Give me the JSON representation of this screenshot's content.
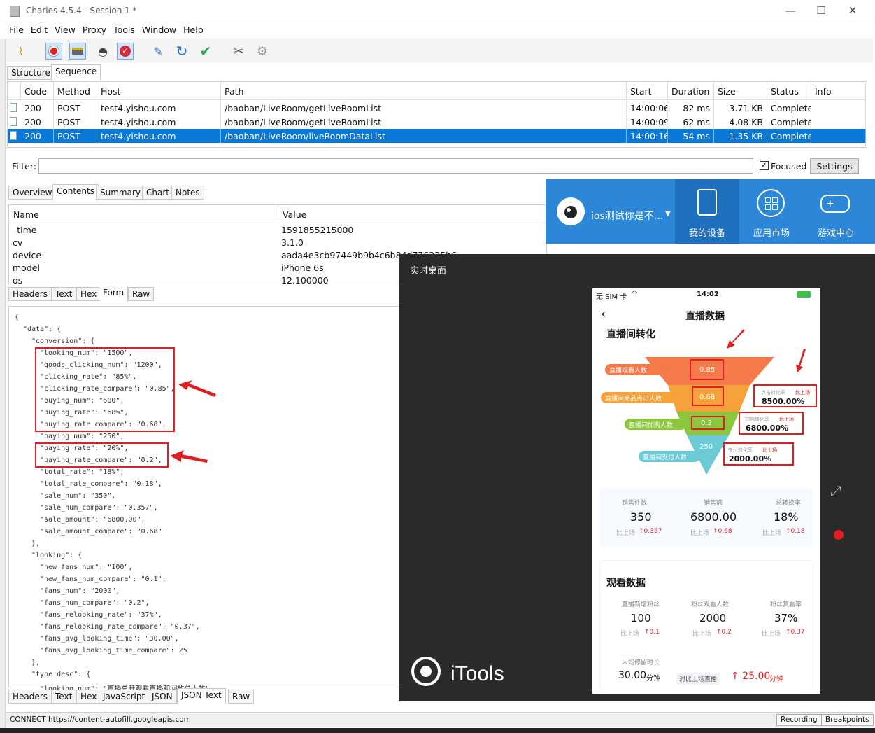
{
  "window": {
    "title": "Charles 4.5.4 - Session 1 *"
  },
  "menu": [
    "File",
    "Edit",
    "View",
    "Proxy",
    "Tools",
    "Window",
    "Help"
  ],
  "toolbar": {
    "icons": [
      "broom-icon",
      "record-icon",
      "throttle-icon",
      "turtle-icon",
      "breakpoint-icon",
      "pen-icon",
      "refresh-icon",
      "check-icon",
      "tools-icon",
      "gear-icon"
    ]
  },
  "view_tabs": [
    "Structure",
    "Sequence"
  ],
  "sequence": {
    "columns": [
      "Code",
      "Method",
      "Host",
      "Path",
      "Start",
      "Duration",
      "Size",
      "Status",
      "Info"
    ],
    "rows": [
      {
        "code": "200",
        "method": "POST",
        "host": "test4.yishou.com",
        "path": "/baoban/LiveRoom/getLiveRoomList",
        "start": "14:00:06",
        "duration": "82 ms",
        "size": "3.71 KB",
        "status": "Complete",
        "info": ""
      },
      {
        "code": "200",
        "method": "POST",
        "host": "test4.yishou.com",
        "path": "/baoban/LiveRoom/getLiveRoomList",
        "start": "14:00:09",
        "duration": "62 ms",
        "size": "4.08 KB",
        "status": "Complete",
        "info": ""
      },
      {
        "code": "200",
        "method": "POST",
        "host": "test4.yishou.com",
        "path": "/baoban/LiveRoom/liveRoomDataList",
        "start": "14:00:16",
        "duration": "54 ms",
        "size": "1.35 KB",
        "status": "Complete",
        "info": ""
      }
    ]
  },
  "filter": {
    "label": "Filter:",
    "value": "",
    "focused_label": "Focused",
    "settings_label": "Settings"
  },
  "detail_tabs": [
    "Overview",
    "Contents",
    "Summary",
    "Chart",
    "Notes"
  ],
  "request_table": {
    "columns": [
      "Name",
      "Value"
    ],
    "rows": [
      {
        "name": "_time",
        "value": "1591855215000"
      },
      {
        "name": "cv",
        "value": "3.1.0"
      },
      {
        "name": "device",
        "value": "aada4e3cb97449b9b4c6b84d776225b6"
      },
      {
        "name": "model",
        "value": "iPhone 6s"
      },
      {
        "name": "os",
        "value": "12.100000"
      }
    ]
  },
  "request_tabs": [
    "Headers",
    "Text",
    "Hex",
    "Form",
    "Raw"
  ],
  "json_lines": [
    {
      "t": "{",
      "i": 0
    },
    {
      "t": "\"data\": {",
      "i": 1
    },
    {
      "t": "\"conversion\": {",
      "i": 2
    },
    {
      "t": "\"looking_num\": \"1500\",",
      "i": 3
    },
    {
      "t": "\"goods_clicking_num\": \"1200\",",
      "i": 3
    },
    {
      "t": "\"clicking_rate\": \"85%\",",
      "i": 3
    },
    {
      "t": "\"clicking_rate_compare\": \"0.85\",",
      "i": 3
    },
    {
      "t": "\"buying_num\": \"600\",",
      "i": 3
    },
    {
      "t": "\"buying_rate\": \"68%\",",
      "i": 3
    },
    {
      "t": "\"buying_rate_compare\": \"0.68\",",
      "i": 3
    },
    {
      "t": "\"paying_num\": \"250\",",
      "i": 3
    },
    {
      "t": "\"paying_rate\": \"20%\",",
      "i": 3
    },
    {
      "t": "\"paying_rate_compare\": \"0.2\",",
      "i": 3
    },
    {
      "t": "\"total_rate\": \"18%\",",
      "i": 3
    },
    {
      "t": "\"total_rate_compare\": \"0.18\",",
      "i": 3
    },
    {
      "t": "\"sale_num\": \"350\",",
      "i": 3
    },
    {
      "t": "\"sale_num_compare\": \"0.357\",",
      "i": 3
    },
    {
      "t": "\"sale_amount\": \"6800.00\",",
      "i": 3
    },
    {
      "t": "\"sale_amount_compare\": \"0.68\"",
      "i": 3
    },
    {
      "t": "},",
      "i": 2
    },
    {
      "t": "\"looking\": {",
      "i": 2
    },
    {
      "t": "\"new_fans_num\": \"100\",",
      "i": 3
    },
    {
      "t": "\"new_fans_num_compare\": \"0.1\",",
      "i": 3
    },
    {
      "t": "\"fans_num\": \"2000\",",
      "i": 3
    },
    {
      "t": "\"fans_num_compare\": \"0.2\",",
      "i": 3
    },
    {
      "t": "\"fans_relooking_rate\": \"37%\",",
      "i": 3
    },
    {
      "t": "\"fans_relooking_rate_compare\": \"0.37\",",
      "i": 3
    },
    {
      "t": "\"fans_avg_looking_time\": \"30.00\",",
      "i": 3
    },
    {
      "t": "\"fans_avg_looking_time_compare\": 25",
      "i": 3
    },
    {
      "t": "},",
      "i": 2
    },
    {
      "t": "\"type_desc\": {",
      "i": 2
    },
    {
      "t": "\"looking_num\": \"直播总开观看直播和回放总人数\",",
      "i": 3
    }
  ],
  "response_tabs": [
    "Headers",
    "Text",
    "Hex",
    "JavaScript",
    "JSON",
    "JSON Text",
    "Raw"
  ],
  "status": {
    "text": "CONNECT https://content-autofill.googleapis.com",
    "recording": "Recording",
    "breakpoints": "Breakpoints"
  },
  "itools": {
    "device_name": "ios测试你是不...",
    "nav": [
      "我的设备",
      "应用市场",
      "游戏中心"
    ],
    "panel_title": "实时桌面",
    "brand": "iTools"
  },
  "phone": {
    "carrier": "无 SIM 卡",
    "time": "14:02",
    "page_title": "直播数据",
    "section1": "直播间转化",
    "funnel_labels": [
      "直播观看人数",
      "直播间商品点击人数",
      "直播间加购人数",
      "直播间支付人数"
    ],
    "funnel_values": [
      "0.85",
      "0.68",
      "0.2",
      "250"
    ],
    "rates": [
      {
        "label": "点击转化率",
        "cmp": "比上场",
        "value": "8500.00%"
      },
      {
        "label": "加购转化率",
        "cmp": "比上场",
        "value": "6800.00%"
      },
      {
        "label": "支付转化率",
        "cmp": "比上场",
        "value": "2000.00%"
      }
    ],
    "stats1": [
      {
        "label": "销售件数",
        "value": "350",
        "cmp": "比上场",
        "delta": "↑0.357"
      },
      {
        "label": "销售额",
        "value": "6800.00",
        "cmp": "比上场",
        "delta": "↑0.68"
      },
      {
        "label": "总转换率",
        "value": "18%",
        "cmp": "比上场",
        "delta": "↑0.18"
      }
    ],
    "section2": "观看数据",
    "stats2": [
      {
        "label": "直播新增粉丝",
        "value": "100",
        "cmp": "比上场",
        "delta": "↑0.1"
      },
      {
        "label": "粉丝观看人数",
        "value": "2000",
        "cmp": "比上场",
        "delta": "↑0.2"
      },
      {
        "label": "粉丝复看率",
        "value": "37%",
        "cmp": "比上场",
        "delta": "↑0.37"
      }
    ],
    "avg_label": "人均停留时长",
    "avg_value": "30.00",
    "avg_unit": "分钟",
    "avg_cmp": "对比上场直播",
    "avg_delta": "↑ 25.00",
    "avg_delta_unit": "分钟"
  },
  "colors": {
    "accent": "#0a78d7",
    "highlight": "#e02020",
    "itools_blue": "#2d87d8"
  }
}
